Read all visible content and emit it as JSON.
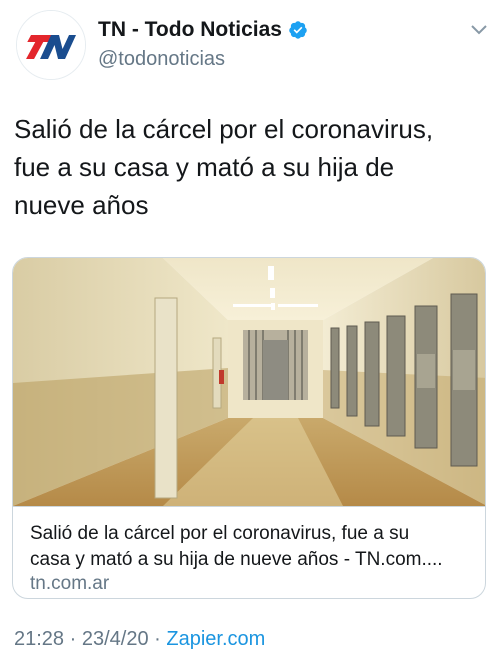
{
  "account": {
    "name": "TN - Todo Noticias",
    "handle": "@todonoticias",
    "avatar_logo": "TN",
    "verified_icon": "verified-badge-icon"
  },
  "tweet": {
    "text": "Salió de la cárcel por el coronavirus,\nfue a su casa y mató a su hija de\nnueve años"
  },
  "card": {
    "title": "Salió de la cárcel por el coronavirus, fue a su\ncasa y mató a su hija de nueve años - TN.com....",
    "domain": "tn.com.ar",
    "image_description_icon": "prison-corridor-image"
  },
  "meta": {
    "time": "21:28",
    "separator1": " · ",
    "date": "23/4/20",
    "separator2": " · ",
    "source": "Zapier.com"
  },
  "colors": {
    "link": "#1b95e0",
    "secondary": "#657786",
    "brand_red": "#e3262c",
    "brand_blue": "#1a4d8f"
  }
}
